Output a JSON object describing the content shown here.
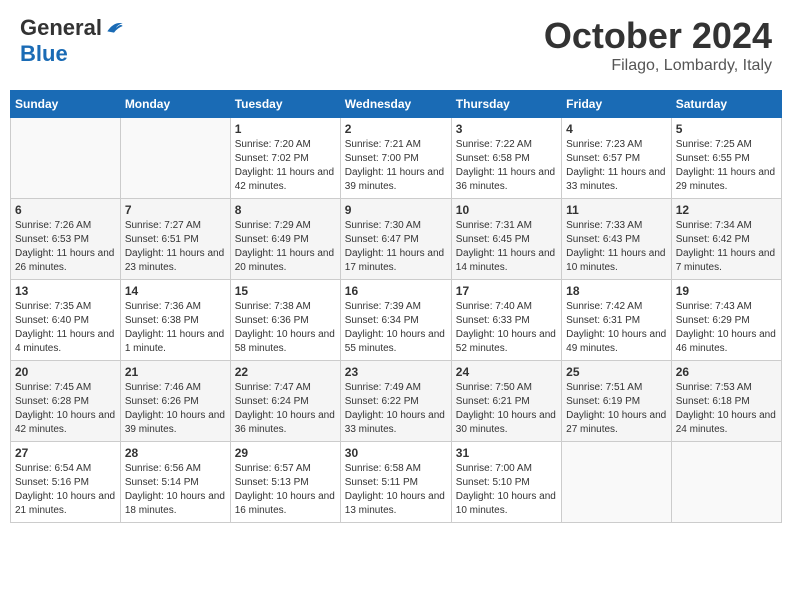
{
  "header": {
    "logo_general": "General",
    "logo_blue": "Blue",
    "month_title": "October 2024",
    "location": "Filago, Lombardy, Italy"
  },
  "weekdays": [
    "Sunday",
    "Monday",
    "Tuesday",
    "Wednesday",
    "Thursday",
    "Friday",
    "Saturday"
  ],
  "weeks": [
    [
      {
        "day": "",
        "info": ""
      },
      {
        "day": "",
        "info": ""
      },
      {
        "day": "1",
        "info": "Sunrise: 7:20 AM\nSunset: 7:02 PM\nDaylight: 11 hours and 42 minutes."
      },
      {
        "day": "2",
        "info": "Sunrise: 7:21 AM\nSunset: 7:00 PM\nDaylight: 11 hours and 39 minutes."
      },
      {
        "day": "3",
        "info": "Sunrise: 7:22 AM\nSunset: 6:58 PM\nDaylight: 11 hours and 36 minutes."
      },
      {
        "day": "4",
        "info": "Sunrise: 7:23 AM\nSunset: 6:57 PM\nDaylight: 11 hours and 33 minutes."
      },
      {
        "day": "5",
        "info": "Sunrise: 7:25 AM\nSunset: 6:55 PM\nDaylight: 11 hours and 29 minutes."
      }
    ],
    [
      {
        "day": "6",
        "info": "Sunrise: 7:26 AM\nSunset: 6:53 PM\nDaylight: 11 hours and 26 minutes."
      },
      {
        "day": "7",
        "info": "Sunrise: 7:27 AM\nSunset: 6:51 PM\nDaylight: 11 hours and 23 minutes."
      },
      {
        "day": "8",
        "info": "Sunrise: 7:29 AM\nSunset: 6:49 PM\nDaylight: 11 hours and 20 minutes."
      },
      {
        "day": "9",
        "info": "Sunrise: 7:30 AM\nSunset: 6:47 PM\nDaylight: 11 hours and 17 minutes."
      },
      {
        "day": "10",
        "info": "Sunrise: 7:31 AM\nSunset: 6:45 PM\nDaylight: 11 hours and 14 minutes."
      },
      {
        "day": "11",
        "info": "Sunrise: 7:33 AM\nSunset: 6:43 PM\nDaylight: 11 hours and 10 minutes."
      },
      {
        "day": "12",
        "info": "Sunrise: 7:34 AM\nSunset: 6:42 PM\nDaylight: 11 hours and 7 minutes."
      }
    ],
    [
      {
        "day": "13",
        "info": "Sunrise: 7:35 AM\nSunset: 6:40 PM\nDaylight: 11 hours and 4 minutes."
      },
      {
        "day": "14",
        "info": "Sunrise: 7:36 AM\nSunset: 6:38 PM\nDaylight: 11 hours and 1 minute."
      },
      {
        "day": "15",
        "info": "Sunrise: 7:38 AM\nSunset: 6:36 PM\nDaylight: 10 hours and 58 minutes."
      },
      {
        "day": "16",
        "info": "Sunrise: 7:39 AM\nSunset: 6:34 PM\nDaylight: 10 hours and 55 minutes."
      },
      {
        "day": "17",
        "info": "Sunrise: 7:40 AM\nSunset: 6:33 PM\nDaylight: 10 hours and 52 minutes."
      },
      {
        "day": "18",
        "info": "Sunrise: 7:42 AM\nSunset: 6:31 PM\nDaylight: 10 hours and 49 minutes."
      },
      {
        "day": "19",
        "info": "Sunrise: 7:43 AM\nSunset: 6:29 PM\nDaylight: 10 hours and 46 minutes."
      }
    ],
    [
      {
        "day": "20",
        "info": "Sunrise: 7:45 AM\nSunset: 6:28 PM\nDaylight: 10 hours and 42 minutes."
      },
      {
        "day": "21",
        "info": "Sunrise: 7:46 AM\nSunset: 6:26 PM\nDaylight: 10 hours and 39 minutes."
      },
      {
        "day": "22",
        "info": "Sunrise: 7:47 AM\nSunset: 6:24 PM\nDaylight: 10 hours and 36 minutes."
      },
      {
        "day": "23",
        "info": "Sunrise: 7:49 AM\nSunset: 6:22 PM\nDaylight: 10 hours and 33 minutes."
      },
      {
        "day": "24",
        "info": "Sunrise: 7:50 AM\nSunset: 6:21 PM\nDaylight: 10 hours and 30 minutes."
      },
      {
        "day": "25",
        "info": "Sunrise: 7:51 AM\nSunset: 6:19 PM\nDaylight: 10 hours and 27 minutes."
      },
      {
        "day": "26",
        "info": "Sunrise: 7:53 AM\nSunset: 6:18 PM\nDaylight: 10 hours and 24 minutes."
      }
    ],
    [
      {
        "day": "27",
        "info": "Sunrise: 6:54 AM\nSunset: 5:16 PM\nDaylight: 10 hours and 21 minutes."
      },
      {
        "day": "28",
        "info": "Sunrise: 6:56 AM\nSunset: 5:14 PM\nDaylight: 10 hours and 18 minutes."
      },
      {
        "day": "29",
        "info": "Sunrise: 6:57 AM\nSunset: 5:13 PM\nDaylight: 10 hours and 16 minutes."
      },
      {
        "day": "30",
        "info": "Sunrise: 6:58 AM\nSunset: 5:11 PM\nDaylight: 10 hours and 13 minutes."
      },
      {
        "day": "31",
        "info": "Sunrise: 7:00 AM\nSunset: 5:10 PM\nDaylight: 10 hours and 10 minutes."
      },
      {
        "day": "",
        "info": ""
      },
      {
        "day": "",
        "info": ""
      }
    ]
  ]
}
